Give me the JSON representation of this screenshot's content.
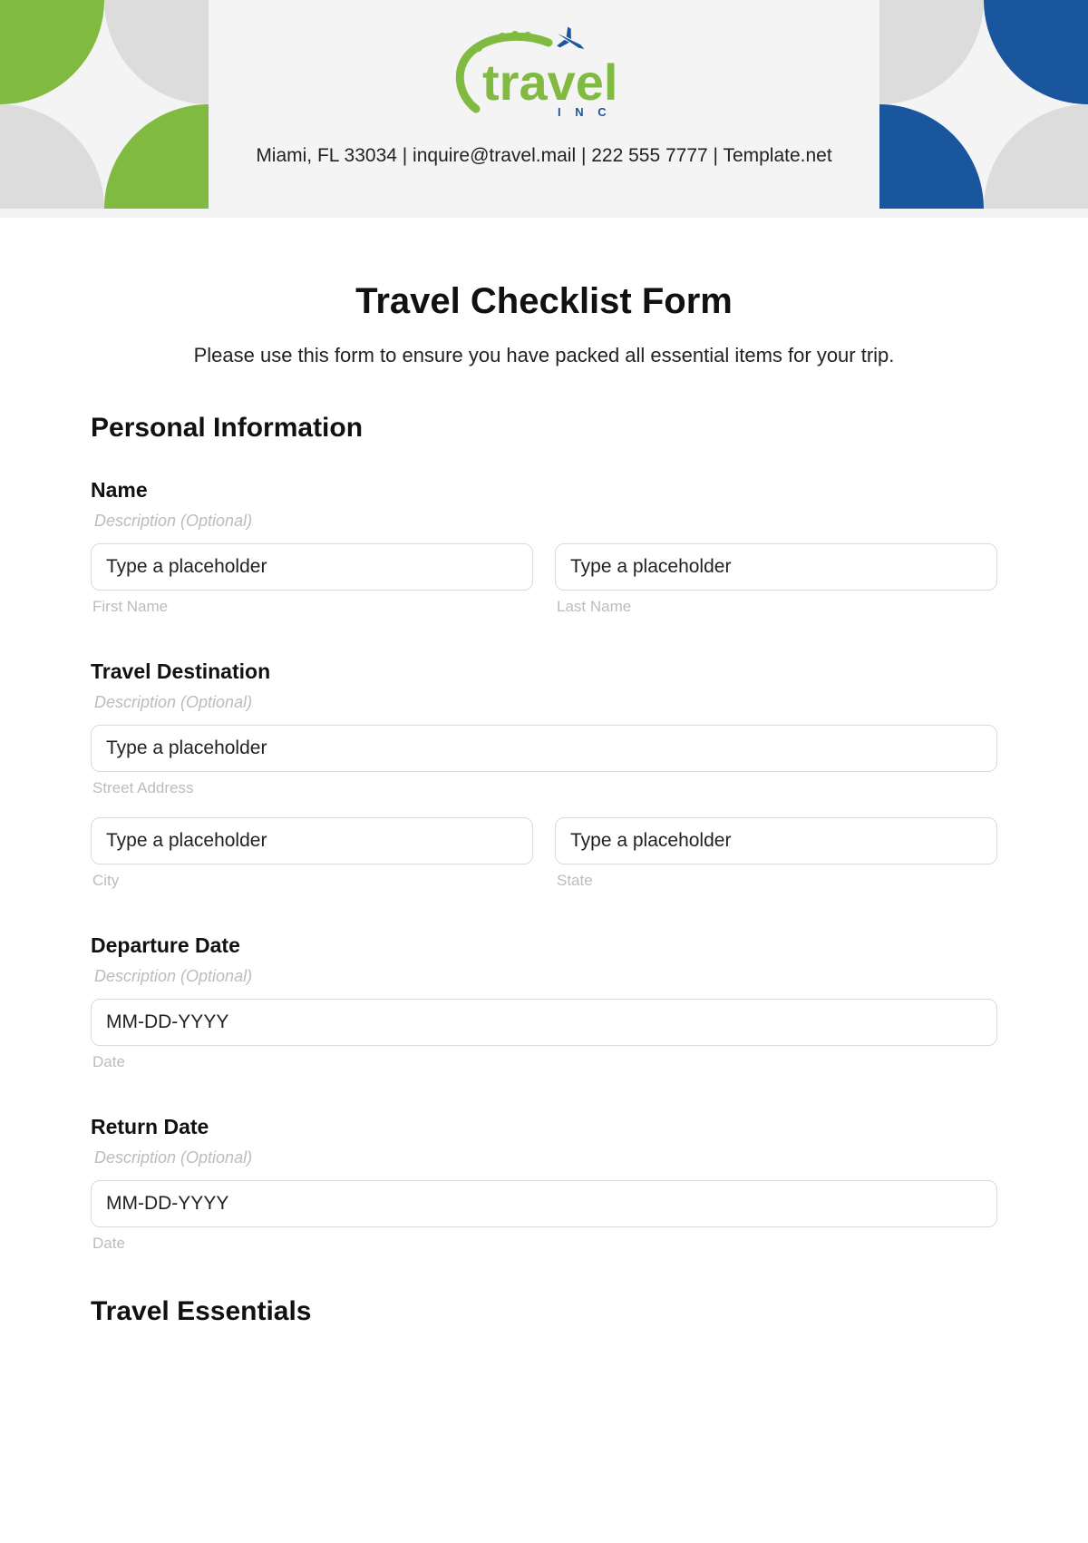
{
  "header": {
    "brand_main": "travel",
    "brand_sub": "I N C",
    "contact": "Miami, FL 33034 | inquire@travel.mail | 222 555 7777 | Template.net"
  },
  "title": "Travel Checklist Form",
  "intro": "Please use this form to ensure you have packed all essential items for your trip.",
  "section_personal": "Personal Information",
  "section_essentials": "Travel Essentials",
  "name": {
    "label": "Name",
    "desc": "Description (Optional)",
    "first_ph": "Type a placeholder",
    "first_sub": "First Name",
    "last_ph": "Type a placeholder",
    "last_sub": "Last Name"
  },
  "destination": {
    "label": "Travel Destination",
    "desc": "Description (Optional)",
    "street_ph": "Type a placeholder",
    "street_sub": "Street Address",
    "city_ph": "Type a placeholder",
    "city_sub": "City",
    "state_ph": "Type a placeholder",
    "state_sub": "State"
  },
  "depart": {
    "label": "Departure Date",
    "desc": "Description (Optional)",
    "ph": "MM-DD-YYYY",
    "sub": "Date"
  },
  "ret": {
    "label": "Return Date",
    "desc": "Description (Optional)",
    "ph": "MM-DD-YYYY",
    "sub": "Date"
  }
}
